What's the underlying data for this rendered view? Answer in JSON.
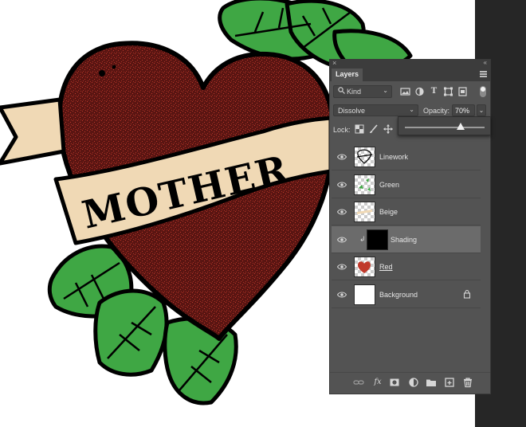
{
  "canvas": {
    "banner_text": "MOTHER",
    "colors": {
      "heart": "#5a1512",
      "heart_speckle": "#c0392b",
      "leaf": "#3fa744",
      "banner": "#f0d9b5",
      "outline": "#000000"
    }
  },
  "panel": {
    "close_glyph": "×",
    "collapse_glyph": "«",
    "tab": "Layers",
    "filter": {
      "kind_label": "Kind",
      "icons": [
        "image-filter-icon",
        "adjustment-filter-icon",
        "type-filter-icon",
        "shape-filter-icon",
        "smart-object-filter-icon"
      ]
    },
    "blend_mode": "Dissolve",
    "opacity_label": "Opacity:",
    "opacity_value": "70%",
    "opacity_slider": 0.7,
    "lock_label": "Lock:",
    "lock_icons": [
      "lock-transparent-pixels-icon",
      "lock-image-pixels-icon",
      "lock-position-icon",
      "lock-artboard-icon"
    ],
    "layers": [
      {
        "name": "Linework",
        "visible": true,
        "selected": false,
        "thumb": "linework",
        "clipped": false,
        "locked": false,
        "underline": false
      },
      {
        "name": "Green",
        "visible": true,
        "selected": false,
        "thumb": "green",
        "clipped": false,
        "locked": false,
        "underline": false
      },
      {
        "name": "Beige",
        "visible": true,
        "selected": false,
        "thumb": "beige",
        "clipped": false,
        "locked": false,
        "underline": false
      },
      {
        "name": "Shading",
        "visible": true,
        "selected": true,
        "thumb": "black",
        "clipped": true,
        "locked": false,
        "underline": false
      },
      {
        "name": "Red",
        "visible": true,
        "selected": false,
        "thumb": "red",
        "clipped": false,
        "locked": false,
        "underline": true
      },
      {
        "name": "Background",
        "visible": true,
        "selected": false,
        "thumb": "white",
        "clipped": false,
        "locked": true,
        "underline": false
      }
    ],
    "footer_icons": [
      "link-layers-icon",
      "fx-icon",
      "add-mask-icon",
      "adjustment-layer-icon",
      "new-group-icon",
      "new-layer-icon",
      "delete-icon"
    ],
    "footer_fx_text": "fx"
  }
}
